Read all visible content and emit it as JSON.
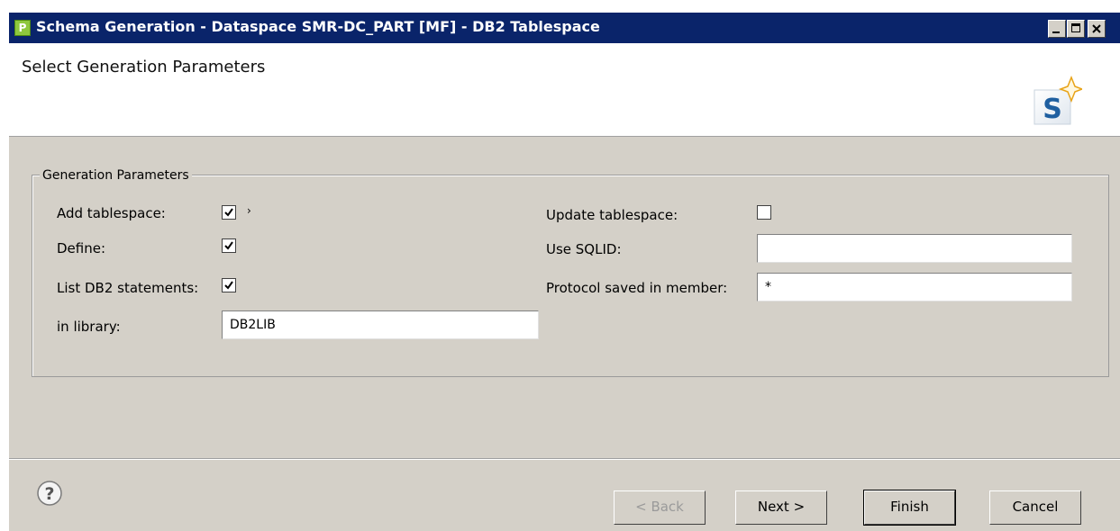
{
  "window": {
    "title": "Schema Generation - Dataspace SMR-DC_PART [MF] - DB2 Tablespace",
    "app_icon": "P"
  },
  "header": {
    "title": "Select Generation Parameters",
    "logo_letter": "S"
  },
  "group": {
    "label": "Generation Parameters"
  },
  "fields": {
    "add_tablespace": {
      "label": "Add tablespace:",
      "checked": true,
      "marker": "›"
    },
    "define": {
      "label": "Define:",
      "checked": true
    },
    "list_db2_statements": {
      "label": "List DB2 statements:",
      "checked": true
    },
    "in_library": {
      "label": "in library:",
      "value": "DB2LIB"
    },
    "update_tablespace": {
      "label": "Update tablespace:",
      "checked": false
    },
    "use_sqlid": {
      "label": "Use SQLID:",
      "value": ""
    },
    "protocol_saved_in_member": {
      "label": "Protocol saved in member:",
      "value": "*"
    }
  },
  "buttons": {
    "back": "< Back",
    "next": "Next >",
    "finish": "Finish",
    "cancel": "Cancel"
  },
  "colors": {
    "titlebar": "#0a246a",
    "dialog_bg": "#d4d0c8",
    "logo_blue": "#1f5fa0",
    "star_gold": "#e8a317"
  }
}
